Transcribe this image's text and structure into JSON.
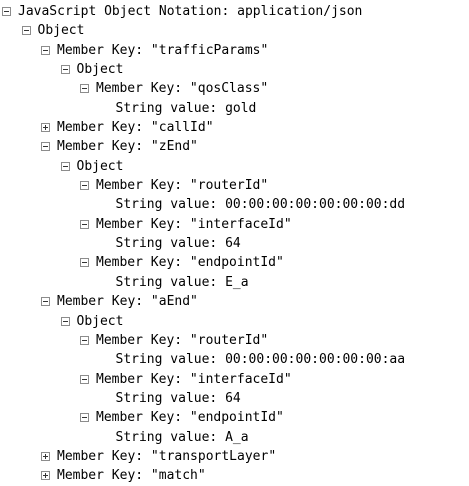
{
  "tree": [
    {
      "depth": 0,
      "state": "expanded",
      "text": "JavaScript Object Notation: application/json"
    },
    {
      "depth": 1,
      "state": "expanded",
      "text": "Object"
    },
    {
      "depth": 2,
      "state": "expanded",
      "text": "Member Key: \"trafficParams\""
    },
    {
      "depth": 3,
      "state": "expanded",
      "text": "Object"
    },
    {
      "depth": 4,
      "state": "expanded",
      "text": "Member Key: \"qosClass\""
    },
    {
      "depth": 5,
      "state": "leaf",
      "text": "String value: gold"
    },
    {
      "depth": 2,
      "state": "collapsed",
      "text": "Member Key: \"callId\""
    },
    {
      "depth": 2,
      "state": "expanded",
      "text": "Member Key: \"zEnd\""
    },
    {
      "depth": 3,
      "state": "expanded",
      "text": "Object"
    },
    {
      "depth": 4,
      "state": "expanded",
      "text": "Member Key: \"routerId\""
    },
    {
      "depth": 5,
      "state": "leaf",
      "text": "String value: 00:00:00:00:00:00:00:dd"
    },
    {
      "depth": 4,
      "state": "expanded",
      "text": "Member Key: \"interfaceId\""
    },
    {
      "depth": 5,
      "state": "leaf",
      "text": "String value: 64"
    },
    {
      "depth": 4,
      "state": "expanded",
      "text": "Member Key: \"endpointId\""
    },
    {
      "depth": 5,
      "state": "leaf",
      "text": "String value: E_a"
    },
    {
      "depth": 2,
      "state": "expanded",
      "text": "Member Key: \"aEnd\""
    },
    {
      "depth": 3,
      "state": "expanded",
      "text": "Object"
    },
    {
      "depth": 4,
      "state": "expanded",
      "text": "Member Key: \"routerId\""
    },
    {
      "depth": 5,
      "state": "leaf",
      "text": "String value: 00:00:00:00:00:00:00:aa"
    },
    {
      "depth": 4,
      "state": "expanded",
      "text": "Member Key: \"interfaceId\""
    },
    {
      "depth": 5,
      "state": "leaf",
      "text": "String value: 64"
    },
    {
      "depth": 4,
      "state": "expanded",
      "text": "Member Key: \"endpointId\""
    },
    {
      "depth": 5,
      "state": "leaf",
      "text": "String value: A_a"
    },
    {
      "depth": 2,
      "state": "collapsed",
      "text": "Member Key: \"transportLayer\""
    },
    {
      "depth": 2,
      "state": "collapsed",
      "text": "Member Key: \"match\""
    }
  ]
}
